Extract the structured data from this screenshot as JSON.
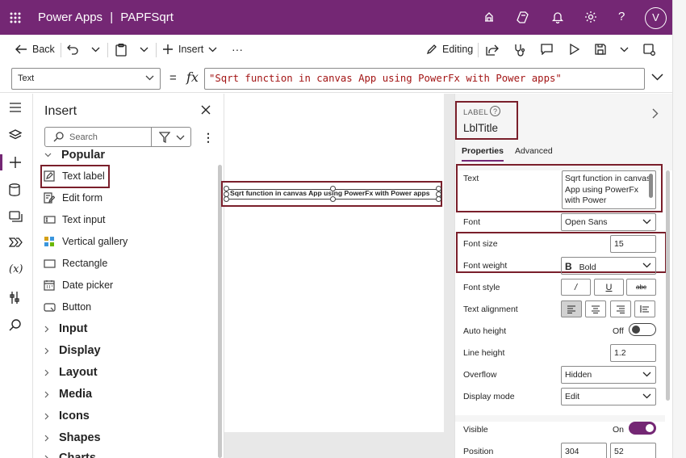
{
  "colors": {
    "brand": "#742774",
    "highlight": "#7a1f2b",
    "formula_text": "#a31515",
    "toggle_on": "#742774"
  },
  "titlebar": {
    "app_name": "Power Apps",
    "separator": "|",
    "project_name": "PAPFSqrt",
    "avatar_initial": "V",
    "icons": [
      "waffle-icon",
      "environment-icon",
      "copilot-icon",
      "bell-icon",
      "gear-icon",
      "help-icon"
    ]
  },
  "commandbar": {
    "back_label": "Back",
    "insert_label": "Insert",
    "more": "···",
    "editing_label": "Editing"
  },
  "formulabar": {
    "property": "Text",
    "equals": "=",
    "fx": "fx",
    "formula": "\"Sqrt function in canvas App using PowerFx with Power apps\""
  },
  "insert_pane": {
    "title": "Insert",
    "search_placeholder": "Search",
    "popular_heading": "Popular",
    "items": [
      {
        "label": "Text label",
        "icon": "text-label-icon"
      },
      {
        "label": "Edit form",
        "icon": "edit-form-icon"
      },
      {
        "label": "Text input",
        "icon": "text-input-icon"
      },
      {
        "label": "Vertical gallery",
        "icon": "gallery-icon"
      },
      {
        "label": "Rectangle",
        "icon": "rectangle-icon"
      },
      {
        "label": "Date picker",
        "icon": "date-picker-icon"
      },
      {
        "label": "Button",
        "icon": "button-icon"
      }
    ],
    "categories": [
      "Input",
      "Display",
      "Layout",
      "Media",
      "Icons",
      "Shapes",
      "Charts"
    ]
  },
  "canvas": {
    "label_text": "Sqrt function in canvas App using PowerFx with Power apps"
  },
  "properties": {
    "control_kind": "LABEL",
    "control_name": "LblTitle",
    "tabs": [
      "Properties",
      "Advanced"
    ],
    "text_label": "Text",
    "text_value": "Sqrt function in canvas App using PowerFx with Power",
    "font_label": "Font",
    "font_value": "Open Sans",
    "font_size_label": "Font size",
    "font_size_value": "15",
    "font_weight_label": "Font weight",
    "font_weight_value": "Bold",
    "font_style_label": "Font style",
    "font_style_buttons": [
      "/",
      "U",
      "abc"
    ],
    "text_alignment_label": "Text alignment",
    "auto_height_label": "Auto height",
    "auto_height_state": "Off",
    "line_height_label": "Line height",
    "line_height_value": "1.2",
    "overflow_label": "Overflow",
    "overflow_value": "Hidden",
    "display_mode_label": "Display mode",
    "display_mode_value": "Edit",
    "visible_label": "Visible",
    "visible_state": "On",
    "position_label": "Position",
    "position_x": "304",
    "position_y": "52"
  }
}
